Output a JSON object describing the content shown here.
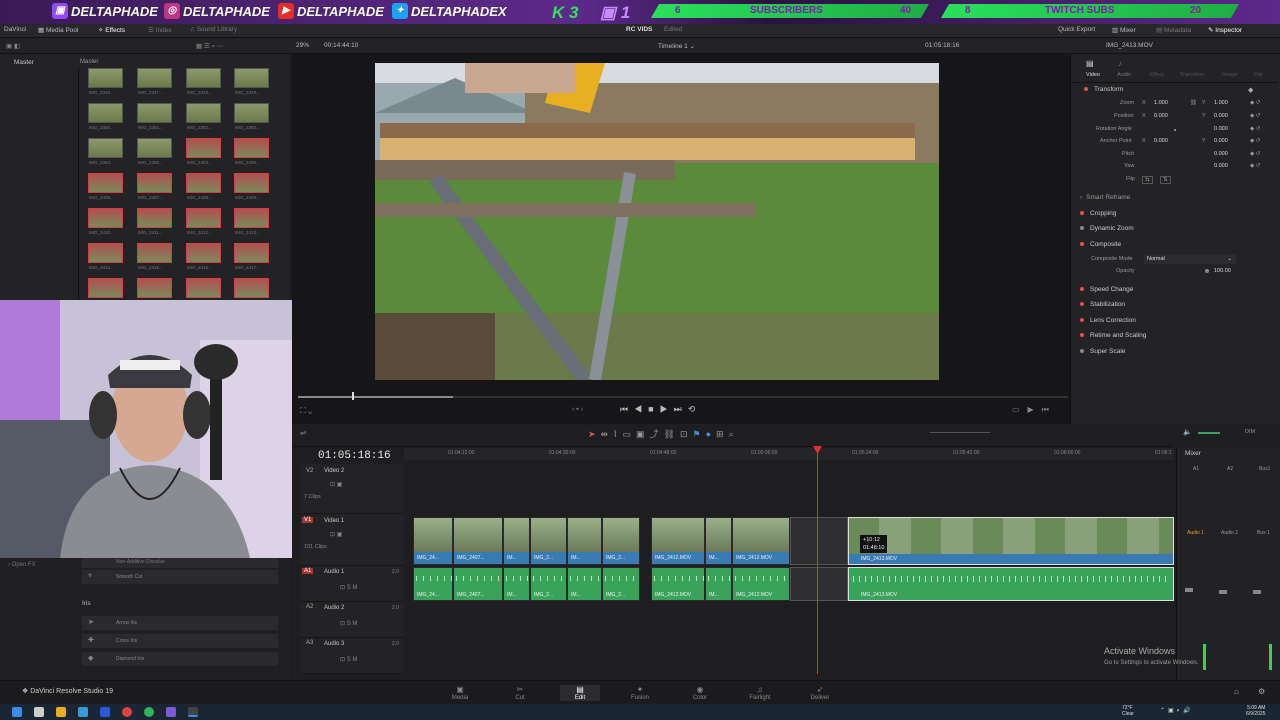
{
  "banner": {
    "handles": [
      "DELTAPHADE",
      "DELTAPHADE",
      "DELTAPHADE",
      "DELTAPHADEX"
    ],
    "kick_count": "3",
    "twitch_count": "1",
    "subscribers_current": "6",
    "subscribers_label": "SUBSCRIBERS",
    "subscribers_goal": "40",
    "twitch_subs_current": "8",
    "twitch_subs_label": "TWITCH SUBS",
    "twitch_subs_goal": "20"
  },
  "toolbar": {
    "app_short": "DaVinci",
    "media_pool": "Media Pool",
    "effects": "Effects",
    "index": "Index",
    "sound_library": "Sound Library",
    "project": "RC VIDS",
    "edited": "Edited",
    "quick_export": "Quick Export",
    "mixer": "Mixer",
    "metadata": "Metadata",
    "inspector": "Inspector"
  },
  "subbar": {
    "zoom": "29%",
    "source_tc": "00:14:44:10",
    "timeline_name": "Timeline 1",
    "record_tc": "01:05:18:16",
    "clip_name": "IMG_2413.MOV"
  },
  "media": {
    "master_left": "Master",
    "master_right": "Master",
    "labels": [
      "IMG_2346...",
      "IMG_2347...",
      "IMG_2348...",
      "IMG_2349...",
      "IMG_2350...",
      "IMG_2351...",
      "IMG_2352...",
      "IMG_2353...",
      "IMG_2354...",
      "IMG_2355...",
      "IMG_2404...",
      "IMG_2405...",
      "IMG_2406...",
      "IMG_2407...",
      "IMG_2408...",
      "IMG_2409...",
      "IMG_2410...",
      "IMG_2411...",
      "IMG_2412...",
      "IMG_2413...",
      "IMG_2414...",
      "IMG_2415...",
      "IMG_2416...",
      "IMG_2417...",
      "IMG_2418...",
      "IMG_2419...",
      "IMG_2420...",
      "IMG_2421..."
    ]
  },
  "effects": {
    "open_fx": "Open FX",
    "non_additive": "Non-Additive Dissolve",
    "smooth_cut": "Smooth Cut",
    "iris": "Iris",
    "arrow_iris": "Arrow Iris",
    "cross_iris": "Cross Iris",
    "diamond_iris": "Diamond Iris"
  },
  "inspector": {
    "tabs": [
      "Video",
      "Audio",
      "Effect",
      "Transition",
      "Image",
      "File"
    ],
    "transform": "Transform",
    "zoom_label": "Zoom",
    "zoom_x": "1.000",
    "zoom_y": "1.000",
    "position_label": "Position",
    "position_x": "0.000",
    "position_y": "0.000",
    "rotation_label": "Rotation Angle",
    "rotation_value": "0.000",
    "anchor_label": "Anchor Point",
    "anchor_x": "0.000",
    "anchor_y": "0.000",
    "pitch_label": "Pitch",
    "pitch_value": "0.000",
    "yaw_label": "Yaw",
    "yaw_value": "0.000",
    "flip_label": "Flip",
    "smart_reframe": "Smart Reframe",
    "cropping": "Cropping",
    "dynamic_zoom": "Dynamic Zoom",
    "composite": "Composite",
    "composite_mode_label": "Composite Mode",
    "composite_mode_value": "Normal",
    "opacity_label": "Opacity",
    "opacity_value": "100.00",
    "speed_change": "Speed Change",
    "stabilization": "Stabilization",
    "lens_correction": "Lens Correction",
    "retime": "Retime and Scaling",
    "super_scale": "Super Scale"
  },
  "timeline": {
    "timecode": "01:05:18:16",
    "ruler": [
      "01:04:12:00",
      "01:04:30:00",
      "01:04:48:00",
      "01:05:06:00",
      "01:05:24:00",
      "01:05:42:00",
      "01:06:00:00",
      "01:06:1"
    ],
    "tracks": {
      "v2_id": "V2",
      "v2_name": "Video 2",
      "v2_clips": "7 Clips",
      "v1_id": "V1",
      "v1_name": "Video 1",
      "v1_clips": "101 Clips",
      "a1_id": "A1",
      "a1_name": "Audio 1",
      "a1_level": "2.0",
      "a2_id": "A2",
      "a2_name": "Audio 2",
      "a2_level": "2.0",
      "a3_id": "A3",
      "a3_name": "Audio 3",
      "a3_level": "2.0"
    },
    "video_clip_labels": [
      "IMG_24...",
      "IMG_2407...",
      "IM...",
      "IMG_2...",
      "IM...",
      "IMG_2...",
      "IMG_2412.MOV",
      "IM...",
      "IMG_2412.MOV"
    ],
    "selected_clip_label": "IMG_2413.MOV",
    "audio_selected_label": "IMG_2413.MOV",
    "drag_tooltip_offset": "+10:12",
    "drag_tooltip_time": "01:48:10",
    "dim": "DIM"
  },
  "mixer": {
    "title": "Mixer",
    "channels": [
      "A1",
      "A2",
      "Bus1"
    ],
    "channel_strip": [
      "Audio 1",
      "Audio 2",
      "Bus 1"
    ]
  },
  "pages": [
    "Media",
    "Cut",
    "Edit",
    "Fusion",
    "Color",
    "Fairlight",
    "Deliver"
  ],
  "active_page": "Edit",
  "app_name": "DaVinci Resolve Studio 19",
  "activate": {
    "title": "Activate Windows",
    "subtitle": "Go to Settings to activate Windows."
  },
  "taskbar": {
    "weather_temp": "72°F",
    "weather_desc": "Clear",
    "time": "5:09 AM",
    "date": "6/9/2025"
  },
  "colors": {
    "banner_purple": "#5c2a8a",
    "accent_green": "#35e05a",
    "video_clip": "#3b7bb3",
    "audio_clip": "#3aa35a",
    "playhead": "#e03030"
  }
}
